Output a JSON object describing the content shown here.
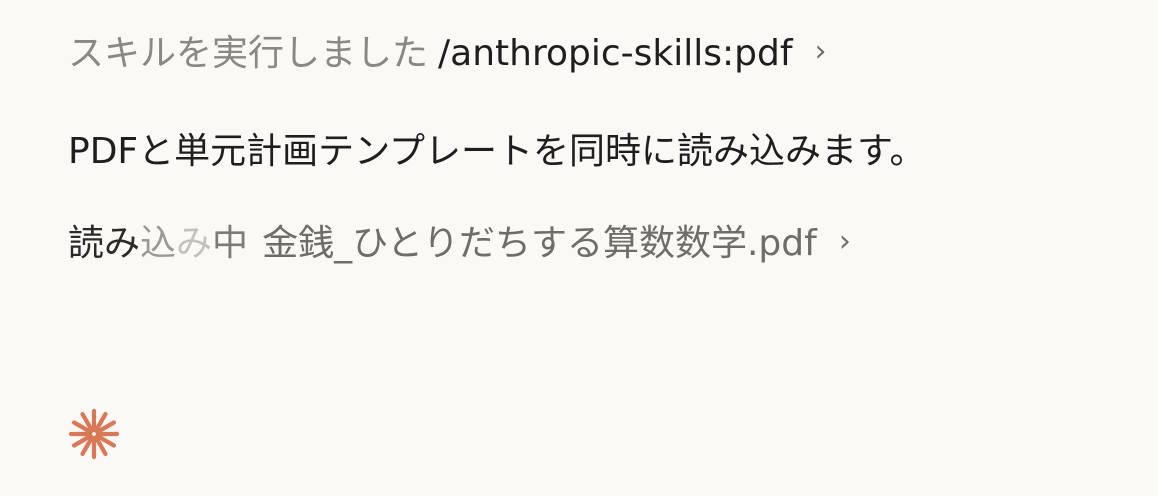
{
  "skill_row": {
    "prefix": "スキルを実行しました",
    "skill_name": "/anthropic-skills:pdf",
    "chevron": "›"
  },
  "message": {
    "text": "PDFと単元計画テンプレートを同時に読み込みます。"
  },
  "loading_row": {
    "status_part1": "読み",
    "status_part2": "込",
    "status_part3": "み",
    "status_part4": "中",
    "file_name": "金銭_ひとりだちする算数数学.pdf",
    "chevron": "›"
  },
  "spinner": {
    "icon": "asterisk-spinner-icon",
    "color": "#d97757"
  }
}
